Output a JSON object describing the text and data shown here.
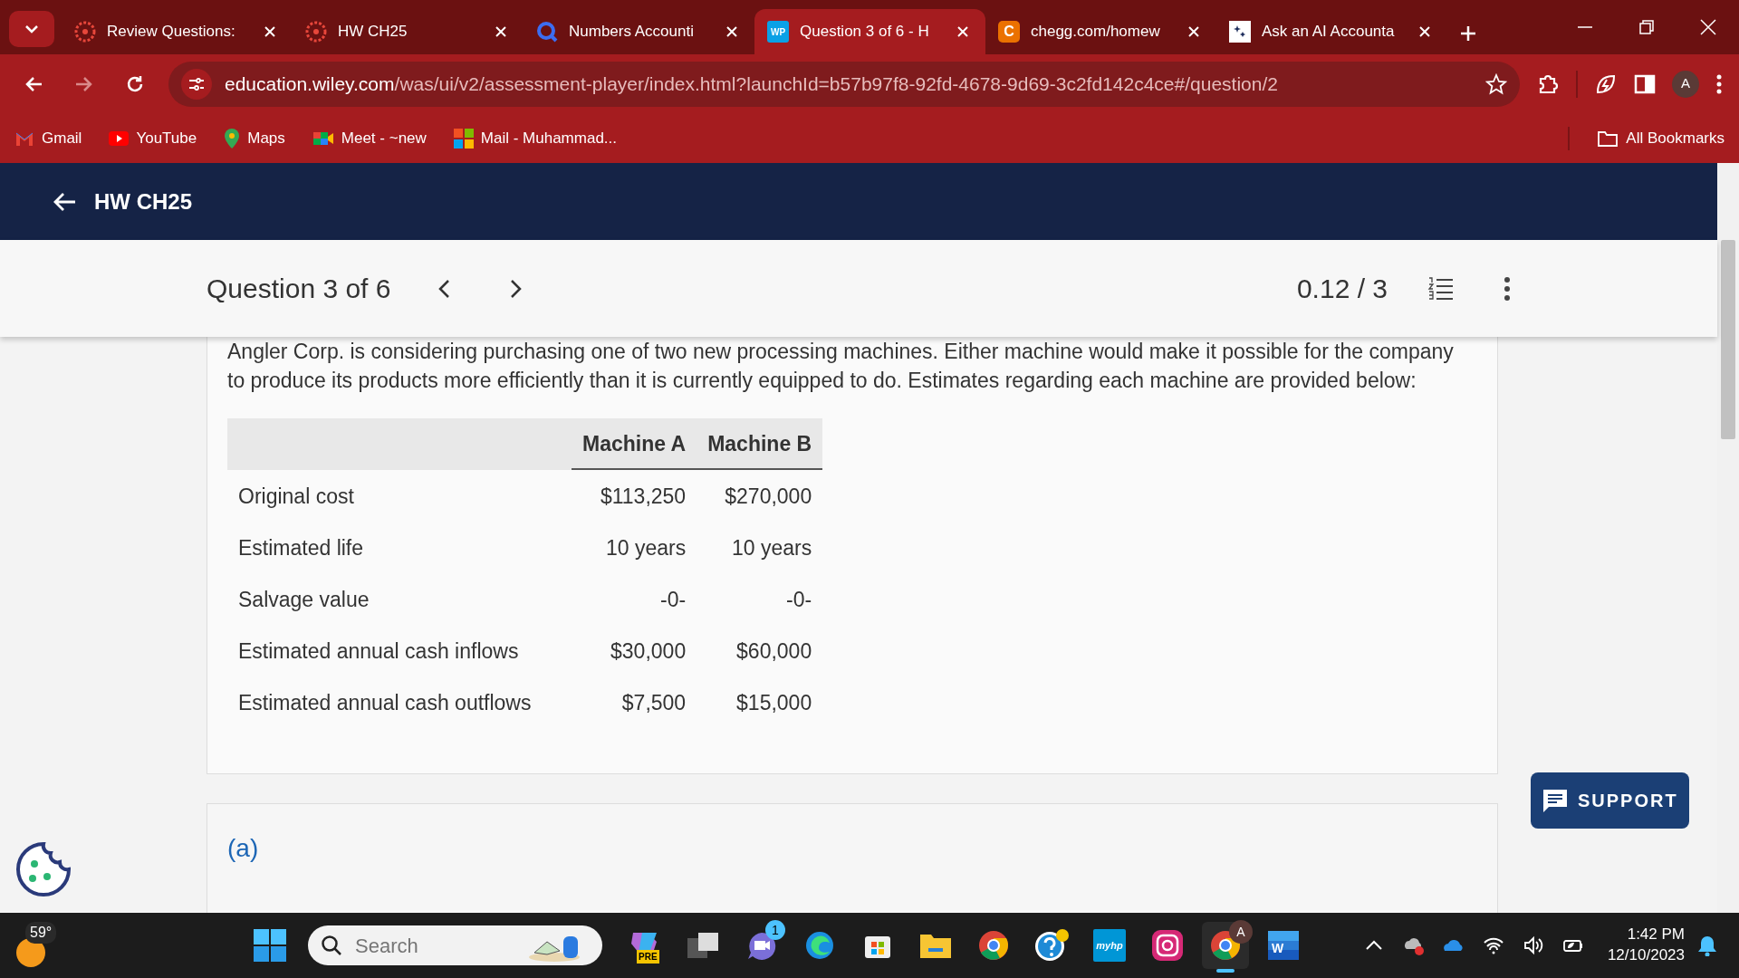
{
  "browser": {
    "tabs": [
      {
        "kind": "canvas",
        "title": "Review Questions:",
        "selected": false
      },
      {
        "kind": "canvas",
        "title": "HW CH25",
        "selected": false
      },
      {
        "kind": "q",
        "title": "Numbers Accounti",
        "selected": false
      },
      {
        "kind": "wp",
        "icon_text": "WP",
        "title": "Question 3 of 6 - H",
        "selected": true
      },
      {
        "kind": "chegg",
        "icon_text": "C",
        "title": "chegg.com/homew",
        "selected": false
      },
      {
        "kind": "ai",
        "title": "Ask an AI Accounta",
        "selected": false
      }
    ],
    "address": {
      "domain": "education.wiley.com",
      "path": "/was/ui/v2/assessment-player/index.html?launchId=b57b97f8-92fd-4678-9d69-3c2fd142c4ce#/question/2"
    },
    "profile": "A",
    "bookmarks": [
      {
        "kind": "gmail",
        "label": "Gmail"
      },
      {
        "kind": "youtube",
        "label": "YouTube"
      },
      {
        "kind": "maps",
        "label": "Maps"
      },
      {
        "kind": "meet",
        "label": "Meet - ~new"
      },
      {
        "kind": "ms",
        "label": "Mail - Muhammad..."
      }
    ],
    "all_bookmarks": "All Bookmarks"
  },
  "app": {
    "title": "HW CH25",
    "question_label": "Question 3 of 6",
    "score": "0.12 / 3",
    "intro": "Angler Corp. is considering purchasing one of two new processing machines. Either machine would make it possible for the company to produce its products more efficiently than it is currently equipped to do. Estimates regarding each machine are provided below:",
    "table": {
      "columns": [
        "",
        "Machine A",
        "Machine B"
      ],
      "rows": [
        [
          "Original cost",
          "$113,250",
          "$270,000"
        ],
        [
          "Estimated life",
          "10 years",
          "10 years"
        ],
        [
          "Salvage value",
          "-0-",
          "-0-"
        ],
        [
          "Estimated annual cash inflows",
          "$30,000",
          "$60,000"
        ],
        [
          "Estimated annual cash outflows",
          "$7,500",
          "$15,000"
        ]
      ]
    },
    "part": "(a)",
    "support": "SUPPORT"
  },
  "taskbar": {
    "weather": "59°",
    "search_placeholder": "Search",
    "apps": [
      {
        "kind": "copilot",
        "icon_text": "PRE"
      },
      {
        "kind": "taskview"
      },
      {
        "kind": "teams",
        "badge": "1"
      },
      {
        "kind": "edge"
      },
      {
        "kind": "store"
      },
      {
        "kind": "folder"
      },
      {
        "kind": "chrome"
      },
      {
        "kind": "help"
      },
      {
        "kind": "myhp",
        "icon_text": "myhp"
      },
      {
        "kind": "instagram"
      },
      {
        "kind": "chrome",
        "badge": "A",
        "active": true
      },
      {
        "kind": "word",
        "icon_text": "W"
      }
    ],
    "time": "1:42 PM",
    "date": "12/10/2023"
  }
}
